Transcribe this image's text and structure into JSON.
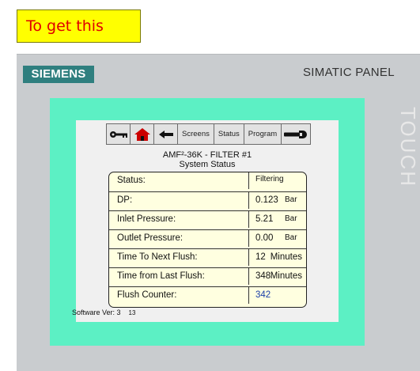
{
  "callout": {
    "text": "To get this"
  },
  "panel": {
    "brand": "SIEMENS",
    "model": "SIMATIC PANEL",
    "side_text": "TOUCH"
  },
  "toolbar": {
    "screens_label": "Screens",
    "status_label": "Status",
    "program_label": "Program",
    "icons": [
      "key-icon",
      "home-icon",
      "back-arrow-icon",
      "wrench-icon"
    ]
  },
  "header": {
    "title": "AMF²-36K -  FILTER #1",
    "subtitle": "System Status"
  },
  "table": {
    "rows": [
      {
        "label": "Status:",
        "value": "Filtering",
        "unit": ""
      },
      {
        "label": "DP:",
        "value": "0.123",
        "unit": "Bar"
      },
      {
        "label": "Inlet Pressure:",
        "value": "5.21",
        "unit": "Bar"
      },
      {
        "label": "Outlet Pressure:",
        "value": "0.00",
        "unit": "Bar"
      },
      {
        "label": "Time To Next Flush:",
        "value": "12",
        "unit": "Minutes"
      },
      {
        "label": "Time from Last Flush:",
        "value": "348",
        "unit": "Minutes"
      },
      {
        "label": "Flush Counter:",
        "value": "342",
        "unit": ""
      }
    ]
  },
  "footer": {
    "label": "Software Ver: 3",
    "minor": "13"
  },
  "colors": {
    "brand_bg": "#2f7f7f",
    "bezel": "#5cf0c4",
    "table_bg": "#ffffe0",
    "callout_bg": "#ffff00",
    "callout_text": "#e00000",
    "home_icon": "#cc0000"
  }
}
